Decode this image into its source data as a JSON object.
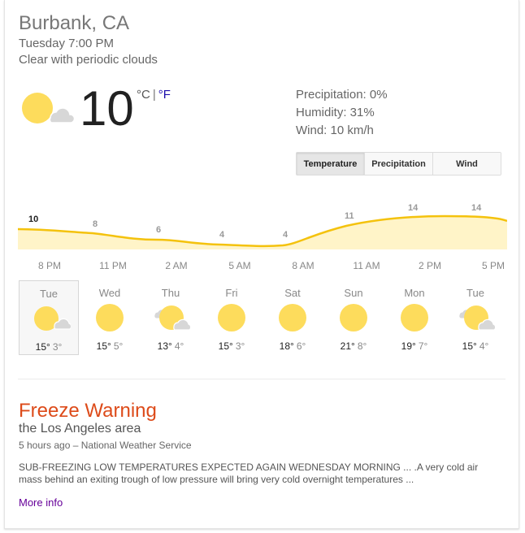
{
  "location": "Burbank, CA",
  "datetime": "Tuesday 7:00 PM",
  "condition": "Clear with periodic clouds",
  "current": {
    "temp": "10",
    "unit_c": "°C",
    "unit_sep": "|",
    "unit_f": "°F",
    "icon": "partly-cloudy-icon"
  },
  "stats": {
    "precipitation": "Precipitation: 0%",
    "humidity": "Humidity: 31%",
    "wind": "Wind: 10 km/h"
  },
  "tabs": [
    {
      "label": "Temperature",
      "active": true
    },
    {
      "label": "Precipitation",
      "active": false
    },
    {
      "label": "Wind",
      "active": false
    }
  ],
  "hourly_chart": {
    "labels": [
      "10",
      "8",
      "6",
      "4",
      "4",
      "11",
      "14",
      "14"
    ],
    "hours": [
      "8 PM",
      "11 PM",
      "2 AM",
      "5 AM",
      "8 AM",
      "11 AM",
      "2 PM",
      "5 PM"
    ],
    "line_color": "#f4c20d",
    "fill_color": "#fff4c8"
  },
  "forecast": [
    {
      "day": "Tue",
      "high": "15°",
      "low": "3°",
      "icon": "partly-cloudy-icon",
      "selected": true
    },
    {
      "day": "Wed",
      "high": "15°",
      "low": "5°",
      "icon": "sunny-icon",
      "selected": false
    },
    {
      "day": "Thu",
      "high": "13°",
      "low": "4°",
      "icon": "mostly-cloudy-icon",
      "selected": false
    },
    {
      "day": "Fri",
      "high": "15°",
      "low": "3°",
      "icon": "sunny-icon",
      "selected": false
    },
    {
      "day": "Sat",
      "high": "18°",
      "low": "6°",
      "icon": "sunny-icon",
      "selected": false
    },
    {
      "day": "Sun",
      "high": "21°",
      "low": "8°",
      "icon": "sunny-icon",
      "selected": false
    },
    {
      "day": "Mon",
      "high": "19°",
      "low": "7°",
      "icon": "sunny-icon",
      "selected": false
    },
    {
      "day": "Tue",
      "high": "15°",
      "low": "4°",
      "icon": "mostly-cloudy-icon",
      "selected": false
    }
  ],
  "warning": {
    "title": "Freeze Warning",
    "area": "the Los Angeles area",
    "meta": "5 hours ago – National Weather Service",
    "body": "SUB-FREEZING LOW TEMPERATURES EXPECTED AGAIN WEDNESDAY MORNING ... .A very cold air mass behind an exiting trough of low pressure will bring very cold overnight temperatures ...",
    "more": "More info"
  },
  "colors": {
    "sun": "#fddc5c",
    "cloud": "#d7d7d7",
    "warning_title": "#dd4b1a",
    "link": "#660099"
  }
}
